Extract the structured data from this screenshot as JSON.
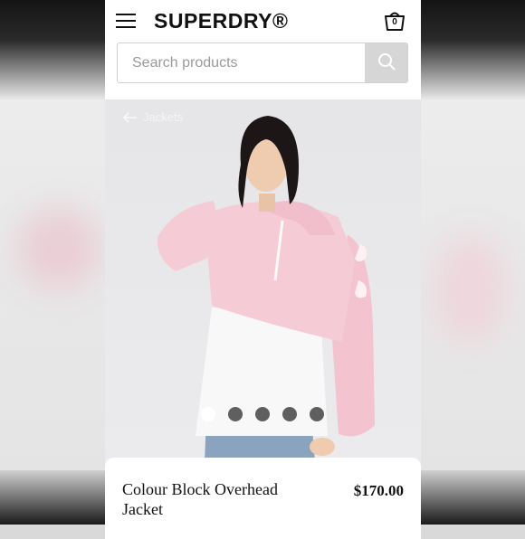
{
  "header": {
    "brand": "SUPERDRY®",
    "basket_count": "0"
  },
  "search": {
    "placeholder": "Search products"
  },
  "breadcrumb": {
    "label": "Jackets"
  },
  "gallery": {
    "image_count": 5,
    "active_index": 0
  },
  "product": {
    "title": "Colour Block Overhead Jacket",
    "price": "$170.00"
  },
  "colors": {
    "jacket_pink": "#f4c9d3",
    "jacket_white": "#f7f7f7",
    "dot_inactive": "#5f5f5f",
    "dot_active": "#ffffff"
  },
  "icons": [
    "menu-icon",
    "basket-icon",
    "search-icon",
    "arrow-left-icon"
  ]
}
